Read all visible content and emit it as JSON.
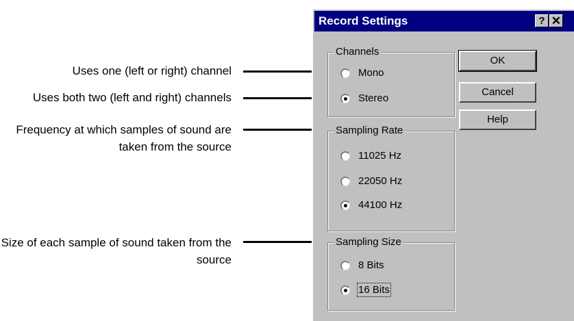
{
  "callouts": [
    {
      "text": "Uses one (left or right) channel"
    },
    {
      "text": "Uses both two (left and right) channels"
    },
    {
      "text": "Frequency at which samples of sound are taken from the source"
    },
    {
      "text": "Size of each sample of sound taken from the source"
    }
  ],
  "dialog": {
    "title": "Record Settings",
    "help_glyph": "?",
    "close_glyph": "✕",
    "channels": {
      "legend": "Channels",
      "options": [
        {
          "label": "Mono",
          "selected": false
        },
        {
          "label": "Stereo",
          "selected": true
        }
      ]
    },
    "sampling_rate": {
      "legend": "Sampling Rate",
      "options": [
        {
          "label": "11025 Hz",
          "selected": false
        },
        {
          "label": "22050 Hz",
          "selected": false
        },
        {
          "label": "44100 Hz",
          "selected": true
        }
      ]
    },
    "sampling_size": {
      "legend": "Sampling Size",
      "options": [
        {
          "label": "8 Bits",
          "selected": false
        },
        {
          "label": "16 Bits",
          "selected": true
        }
      ]
    },
    "buttons": {
      "ok": "OK",
      "cancel": "Cancel",
      "help": "Help"
    }
  }
}
